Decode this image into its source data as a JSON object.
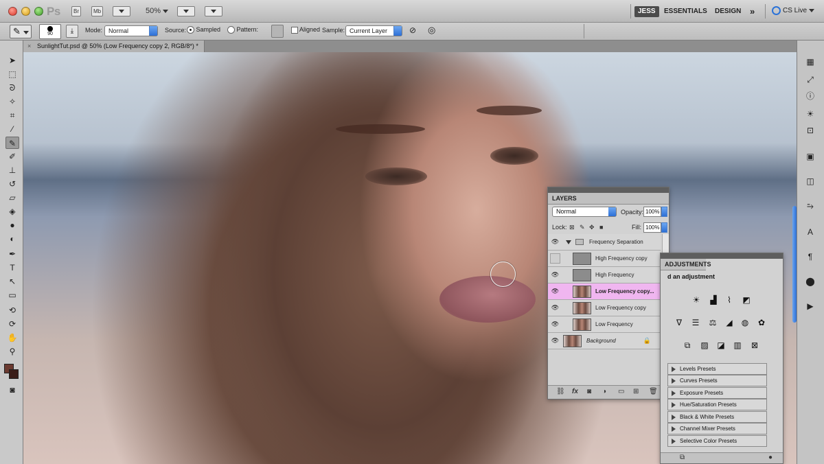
{
  "appbar": {
    "app_logo": "Ps",
    "bridge_label": "Br",
    "minibridge_label": "Mb",
    "zoom": "50%",
    "workspace_user": "JESS",
    "workspace_essentials": "ESSENTIALS",
    "workspace_design": "DESIGN",
    "more_label": "»",
    "cslive": "CS Live"
  },
  "options": {
    "brush_size": "90",
    "mode_label": "Mode:",
    "mode_value": "Normal",
    "source_label": "Source:",
    "sampled_label": "Sampled",
    "pattern_label": "Pattern:",
    "aligned_label": "Aligned",
    "sample_label": "Sample:",
    "sample_value": "Current Layer"
  },
  "document": {
    "tab_title": "SunlightTut.psd @ 50% (Low Frequency copy 2, RGB/8*) *",
    "close": "×"
  },
  "layers": {
    "tab": "LAYERS",
    "blend_mode": "Normal",
    "opacity_label": "Opacity:",
    "opacity_value": "100%",
    "lock_label": "Lock:",
    "fill_label": "Fill:",
    "fill_value": "100%",
    "rows": [
      {
        "name": "Frequency Separation",
        "type": "group",
        "visible": true
      },
      {
        "name": "High Frequency copy",
        "type": "gray",
        "visible": false
      },
      {
        "name": "High Frequency",
        "type": "gray",
        "visible": true
      },
      {
        "name": "Low Frequency copy...",
        "type": "photo",
        "visible": true,
        "selected": true
      },
      {
        "name": "Low Frequency copy",
        "type": "photo",
        "visible": true
      },
      {
        "name": "Low Frequency",
        "type": "photo",
        "visible": true
      },
      {
        "name": "Background",
        "type": "photo",
        "visible": true,
        "locked": true
      }
    ]
  },
  "adjustments": {
    "tab": "ADJUSTMENTS",
    "hint": "d an adjustment",
    "presets": [
      "Levels Presets",
      "Curves Presets",
      "Exposure Presets",
      "Hue/Saturation Presets",
      "Black & White Presets",
      "Channel Mixer Presets",
      "Selective Color Presets"
    ]
  },
  "icons": {
    "eye": "eye-icon",
    "lock": "lock-icon",
    "folder": "folder-icon",
    "brush": "healing-brush-icon"
  },
  "colors": {
    "selected_layer": "#f0b6f0",
    "accent_blue": "#2d6fd6",
    "foreground": "#6b3a30",
    "background": "#3a1d18"
  }
}
